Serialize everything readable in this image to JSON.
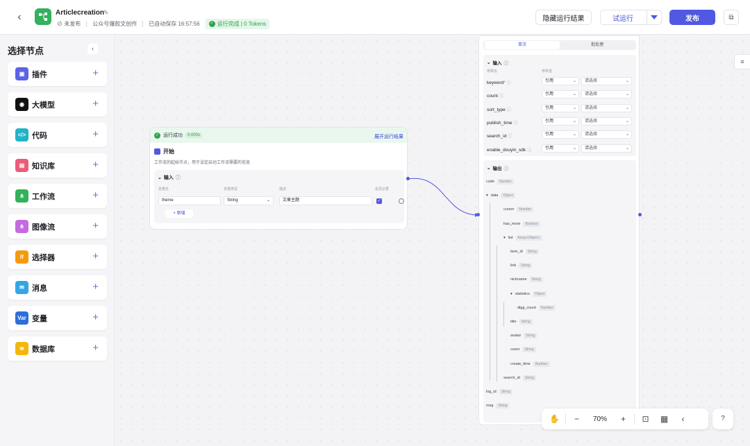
{
  "header": {
    "title": "Articlecreation",
    "status_unpublished": "未发布",
    "workspace": "公众号爆款文创作",
    "autosave": "已自动保存 16:57:56",
    "run_status": "运行完成 | 0 Tokens",
    "hide_results": "隐藏运行结果",
    "test_run": "试运行",
    "publish": "发布"
  },
  "sidebar": {
    "title": "选择节点",
    "items": [
      {
        "label": "插件",
        "icon": "plugin-icon",
        "color": "#5b63e6",
        "glyph": "▣"
      },
      {
        "label": "大模型",
        "icon": "llm-icon",
        "color": "#111111",
        "glyph": "◉"
      },
      {
        "label": "代码",
        "icon": "code-icon",
        "color": "#22b3c7",
        "glyph": "</>"
      },
      {
        "label": "知识库",
        "icon": "knowledge-icon",
        "color": "#ec5b78",
        "glyph": "▤"
      },
      {
        "label": "工作流",
        "icon": "workflow-icon",
        "color": "#33b15b",
        "glyph": "⋔"
      },
      {
        "label": "图像流",
        "icon": "imageflow-icon",
        "color": "#c46be0",
        "glyph": "⋔"
      },
      {
        "label": "选择器",
        "icon": "selector-icon",
        "color": "#f59a0c",
        "glyph": "If"
      },
      {
        "label": "消息",
        "icon": "message-icon",
        "color": "#33a6e6",
        "glyph": "✉"
      },
      {
        "label": "变量",
        "icon": "variable-icon",
        "color": "#2d6fd8",
        "glyph": "Var"
      },
      {
        "label": "数据库",
        "icon": "database-icon",
        "color": "#f5b60c",
        "glyph": "≋"
      }
    ]
  },
  "start_node": {
    "status": "运行成功",
    "time": "0.000s",
    "expand_link": "展开运行结果",
    "title": "开始",
    "description": "工作流的起始节点，用于设定启动工作流需要的信息",
    "section_title": "输入",
    "col_name": "变量名",
    "col_type": "变量类型",
    "col_desc": "描述",
    "col_required": "是否必要",
    "param_name": "theme",
    "param_type": "String",
    "param_desc": "文章主题",
    "add_label": "新增"
  },
  "right_node": {
    "tab_single": "单次",
    "tab_batch": "批处理",
    "input_title": "输入",
    "col_param": "参数名",
    "col_value": "参数值",
    "params": [
      {
        "name": "keyword",
        "required": "*",
        "mode": "引用",
        "value": "请选择"
      },
      {
        "name": "count",
        "required": "",
        "mode": "引用",
        "value": "请选择"
      },
      {
        "name": "sort_type",
        "required": "",
        "mode": "引用",
        "value": "请选择"
      },
      {
        "name": "publish_time",
        "required": "",
        "mode": "引用",
        "value": "请选择"
      },
      {
        "name": "search_id",
        "required": "",
        "mode": "引用",
        "value": "请选择"
      },
      {
        "name": "enable_douyin_sdk",
        "required": "",
        "mode": "引用",
        "value": "请选择"
      }
    ],
    "output_title": "输出",
    "outputs": [
      {
        "name": "code",
        "type": "Number"
      },
      {
        "name": "data",
        "type": "Object"
      },
      {
        "name": "cursor",
        "type": "Number"
      },
      {
        "name": "has_more",
        "type": "Boolean"
      },
      {
        "name": "list",
        "type": "Array<Object>"
      },
      {
        "name": "item_id",
        "type": "String"
      },
      {
        "name": "link",
        "type": "String"
      },
      {
        "name": "nickname",
        "type": "String"
      },
      {
        "name": "statistics",
        "type": "Object"
      },
      {
        "name": "digg_count",
        "type": "Number"
      },
      {
        "name": "title",
        "type": "String"
      },
      {
        "name": "avatar",
        "type": "String"
      },
      {
        "name": "cover",
        "type": "String"
      },
      {
        "name": "create_time",
        "type": "Number"
      },
      {
        "name": "search_id",
        "type": "String"
      },
      {
        "name": "log_id",
        "type": "String"
      },
      {
        "name": "msg",
        "type": "String"
      }
    ]
  },
  "toolbar": {
    "zoom": "70%"
  }
}
